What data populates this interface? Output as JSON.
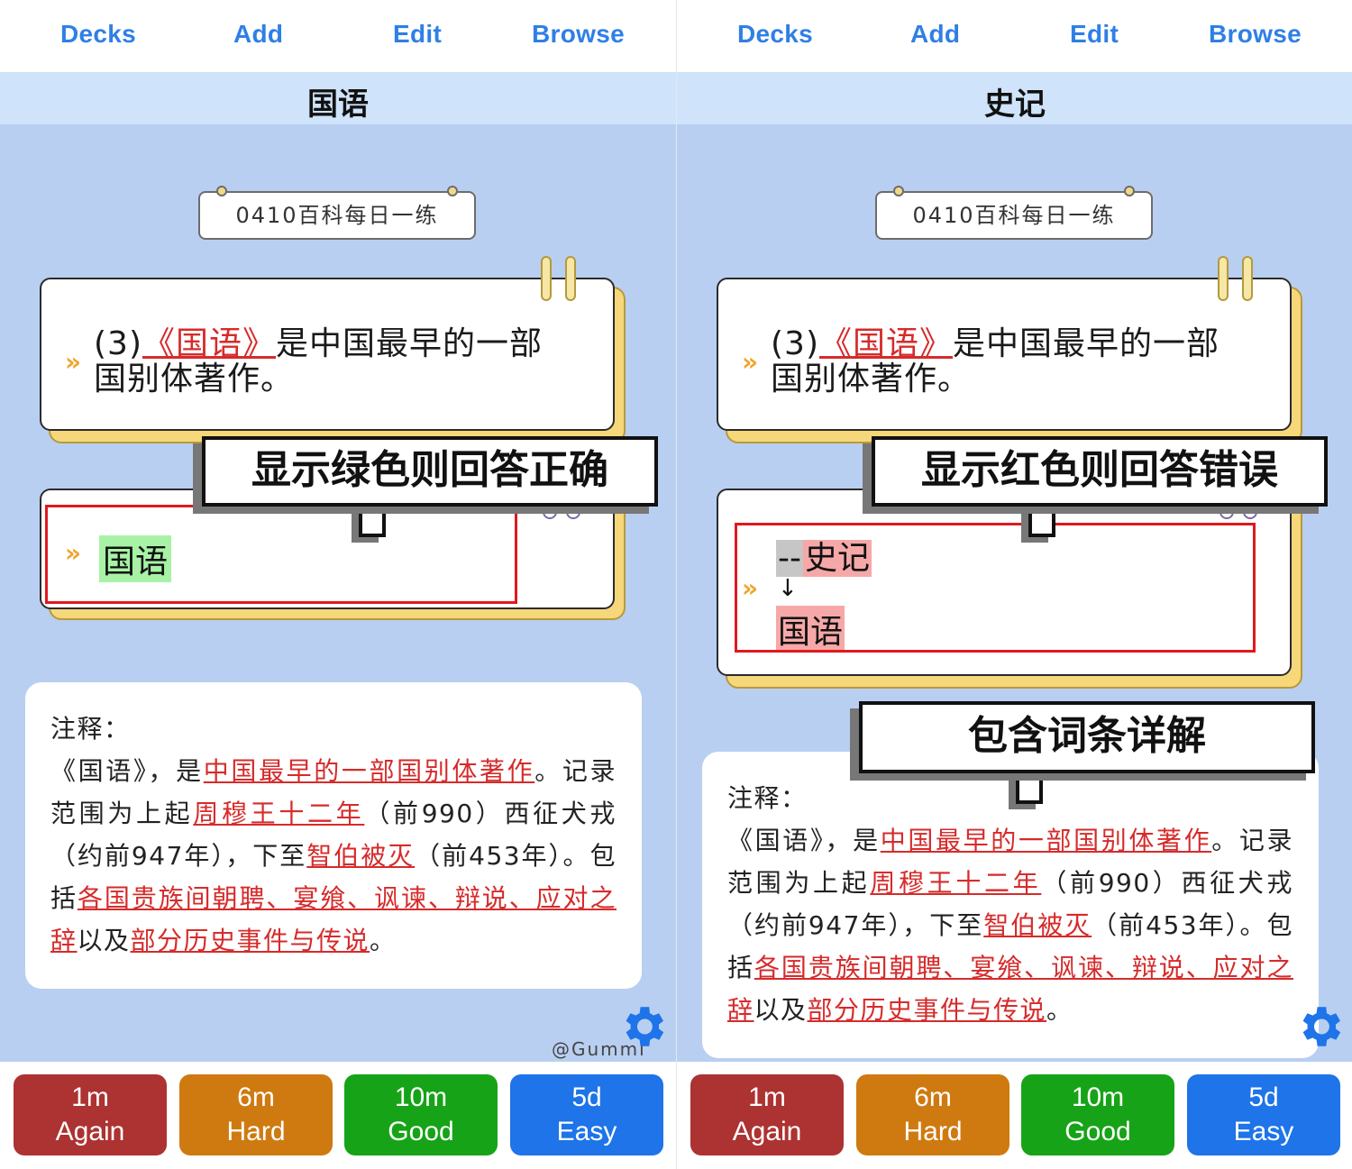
{
  "nav": {
    "decks": "Decks",
    "add": "Add",
    "edit": "Edit",
    "browse": "Browse"
  },
  "deck_tag": "0410百科每日一练",
  "question": {
    "prefix": "(3)",
    "highlight": "《国语》",
    "rest_line1": "是中国最早的一部",
    "line2": "国别体著作。"
  },
  "left": {
    "title": "国语",
    "callout": "显示绿色则回答正确",
    "answer": "国语",
    "watermark": "@Gummi"
  },
  "right": {
    "title": "史记",
    "callout": "显示红色则回答错误",
    "typed_prefix": "--",
    "typed": "史记",
    "arrow": "↓",
    "correct": "国语",
    "callout2": "包含词条详解"
  },
  "note": {
    "label": "注释：",
    "p1_a": "《国语》，是",
    "p1_hl": "中国最早的一部国别体著作",
    "p1_b": "。记录范围为上起",
    "p2_hl": "周穆王十二年",
    "p2_b": "（前990）西征犬戎（约前947年），下至",
    "p3_hl": "智伯被灭",
    "p3_b": "（前453年）。包括",
    "p4_hl": "各国贵族间朝聘、宴飨、讽谏、辩说、应对之辞",
    "p4_b": "以及",
    "p5_hl": "部分历史事件与传说",
    "p5_b": "。"
  },
  "buttons": [
    {
      "time": "1m",
      "label": "Again"
    },
    {
      "time": "6m",
      "label": "Hard"
    },
    {
      "time": "10m",
      "label": "Good"
    },
    {
      "time": "5d",
      "label": "Easy"
    }
  ],
  "colors": {
    "again": "#ad3232",
    "hard": "#cf7a10",
    "good": "#17a317",
    "easy": "#1e74e8",
    "link": "#2f7fe6"
  },
  "icons": {
    "settings": "gear-icon",
    "bullet": "chevron-right-icon"
  }
}
